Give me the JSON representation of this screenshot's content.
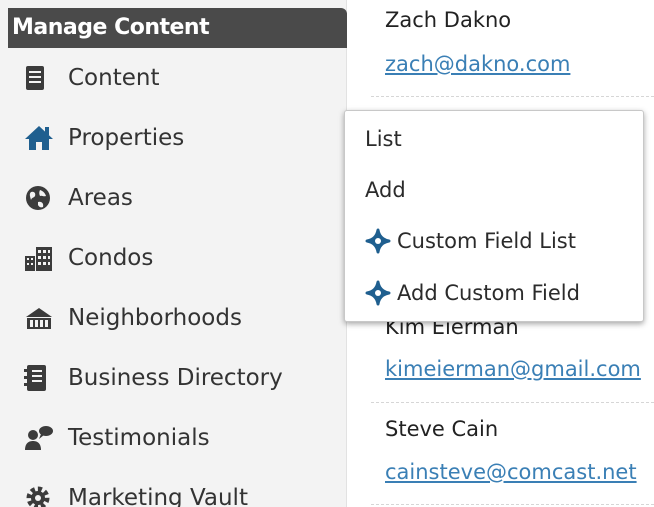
{
  "sidebar": {
    "title": "Manage Content",
    "items": [
      {
        "label": "Content",
        "icon": "document-icon"
      },
      {
        "label": "Properties",
        "icon": "house-icon"
      },
      {
        "label": "Areas",
        "icon": "globe-icon"
      },
      {
        "label": "Condos",
        "icon": "building-icon"
      },
      {
        "label": "Neighborhoods",
        "icon": "neighborhood-icon"
      },
      {
        "label": "Business Directory",
        "icon": "address-book-icon"
      },
      {
        "label": "Testimonials",
        "icon": "testimonial-icon"
      },
      {
        "label": "Marketing Vault",
        "icon": "gear-icon"
      }
    ]
  },
  "contacts": [
    {
      "name": "Zach Dakno",
      "email": "zach@dakno.com"
    },
    {
      "name": "Kim Eierman",
      "email": "kimeierman@gmail.com"
    },
    {
      "name": "Steve Cain",
      "email": "cainsteve@comcast.net"
    }
  ],
  "flyout": {
    "items": [
      {
        "label": "List"
      },
      {
        "label": "Add"
      },
      {
        "label": "Custom Field List",
        "icon": "diamond-icon"
      },
      {
        "label": "Add Custom Field",
        "icon": "diamond-icon"
      }
    ]
  },
  "colors": {
    "sidebar_bg": "#f3f3f3",
    "header_bg": "#4a4a4a",
    "link": "#3a7fb5",
    "icon_blue": "#1f5f8f",
    "icon_dark": "#3b3b3b"
  }
}
